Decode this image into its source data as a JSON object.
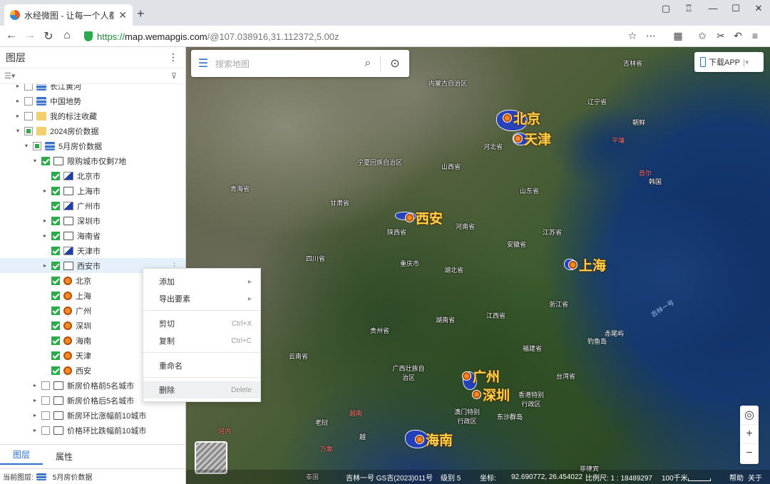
{
  "browser": {
    "tab_title": "水经微图 - 让每一个人都有图",
    "url_protocol": "https://",
    "url_host": "map.wemapgis.com",
    "url_rest": "/@107.038916,31.112372,5.00z"
  },
  "panel": {
    "title": "图层",
    "tree": [
      {
        "label": "长江黄河",
        "level": 1,
        "caret": "▸",
        "check": "off",
        "icon": "layer"
      },
      {
        "label": "中国地势",
        "level": 1,
        "caret": "▸",
        "check": "off",
        "icon": "layer"
      },
      {
        "label": "我的标注收藏",
        "level": 1,
        "caret": "▸",
        "check": "off",
        "icon": "folder"
      },
      {
        "label": "2024房价数据",
        "level": 1,
        "caret": "▾",
        "check": "part",
        "icon": "folder"
      },
      {
        "label": "5月房价数据",
        "level": 2,
        "caret": "▾",
        "check": "part",
        "icon": "layer"
      },
      {
        "label": "限购城市仅剩7地",
        "level": 3,
        "caret": "▾",
        "check": "on",
        "icon": "folder-g"
      },
      {
        "label": "北京市",
        "level": 4,
        "caret": "",
        "check": "on",
        "icon": "poly"
      },
      {
        "label": "上海市",
        "level": 4,
        "caret": "▸",
        "check": "on",
        "icon": "folder-g"
      },
      {
        "label": "广州市",
        "level": 4,
        "caret": "",
        "check": "on",
        "icon": "poly"
      },
      {
        "label": "深圳市",
        "level": 4,
        "caret": "▸",
        "check": "on",
        "icon": "folder-g"
      },
      {
        "label": "海南省",
        "level": 4,
        "caret": "▸",
        "check": "on",
        "icon": "folder-g"
      },
      {
        "label": "天津市",
        "level": 4,
        "caret": "",
        "check": "on",
        "icon": "poly"
      },
      {
        "label": "西安市",
        "level": 4,
        "caret": "▸",
        "check": "on",
        "icon": "folder-g",
        "selected": true
      },
      {
        "label": "北京",
        "level": 4,
        "caret": "",
        "check": "on",
        "icon": "pt"
      },
      {
        "label": "上海",
        "level": 4,
        "caret": "",
        "check": "on",
        "icon": "pt"
      },
      {
        "label": "广州",
        "level": 4,
        "caret": "",
        "check": "on",
        "icon": "pt"
      },
      {
        "label": "深圳",
        "level": 4,
        "caret": "",
        "check": "on",
        "icon": "pt"
      },
      {
        "label": "海南",
        "level": 4,
        "caret": "",
        "check": "on",
        "icon": "pt"
      },
      {
        "label": "天津",
        "level": 4,
        "caret": "",
        "check": "on",
        "icon": "pt"
      },
      {
        "label": "西安",
        "level": 4,
        "caret": "",
        "check": "on",
        "icon": "pt"
      },
      {
        "label": "新房价格前5名城市",
        "level": 3,
        "caret": "▸",
        "check": "off",
        "icon": "folder-g"
      },
      {
        "label": "新房价格后5名城市",
        "level": 3,
        "caret": "▸",
        "check": "off",
        "icon": "folder-g"
      },
      {
        "label": "新房环比涨幅前10城市",
        "level": 3,
        "caret": "▸",
        "check": "off",
        "icon": "folder-g"
      },
      {
        "label": "价格环比跌幅前10城市",
        "level": 3,
        "caret": "▸",
        "check": "off",
        "icon": "folder-g"
      }
    ],
    "tabs": [
      "图层",
      "属性"
    ],
    "status_label": "当前图层:",
    "status_value": "5月房价数据"
  },
  "context_menu": {
    "items": [
      {
        "label": "添加",
        "shortcut": "▸"
      },
      {
        "label": "导出要素",
        "shortcut": "▸"
      },
      {
        "label": "剪切",
        "shortcut": "Ctrl+X"
      },
      {
        "label": "复制",
        "shortcut": "Ctrl+C"
      },
      {
        "label": "重命名",
        "shortcut": ""
      },
      {
        "label": "删除",
        "shortcut": "Delete"
      }
    ]
  },
  "map": {
    "search_placeholder": "搜索地图",
    "download_label": "下载APP",
    "cities": [
      "北京",
      "天津",
      "西安",
      "上海",
      "广州",
      "深圳",
      "海南"
    ],
    "provinces": [
      "内蒙古自治区",
      "吉林省",
      "辽宁省",
      "朝鲜",
      "韩国",
      "河北省",
      "山西省",
      "宁夏回族自治区",
      "青海省",
      "甘肃省",
      "山东省",
      "陕西省",
      "河南省",
      "江苏省",
      "安徽省",
      "四川省",
      "重庆市",
      "湖北省",
      "浙江省",
      "湖南省",
      "江西省",
      "贵州省",
      "福建省",
      "台湾省",
      "云南省",
      "广西壮族自治区",
      "香港特别行政区",
      "澳门特别行政区",
      "越南",
      "老挝",
      "泰国",
      "菲律宾",
      "越",
      "钓鱼岛",
      "赤尾屿",
      "东沙群岛",
      "平壤",
      "首尔",
      "河内",
      "万象"
    ],
    "sea_label": "吉林一号",
    "status": {
      "copyright": "吉林一号 GS吉(2023)011号",
      "level": "级别 5",
      "coord_label": "坐标:",
      "coord_value": "92.690772, 26.454022",
      "scale": "比例尺: 1 : 18489297",
      "scalebar": "100千米",
      "help": "帮助",
      "about": "关于"
    }
  }
}
